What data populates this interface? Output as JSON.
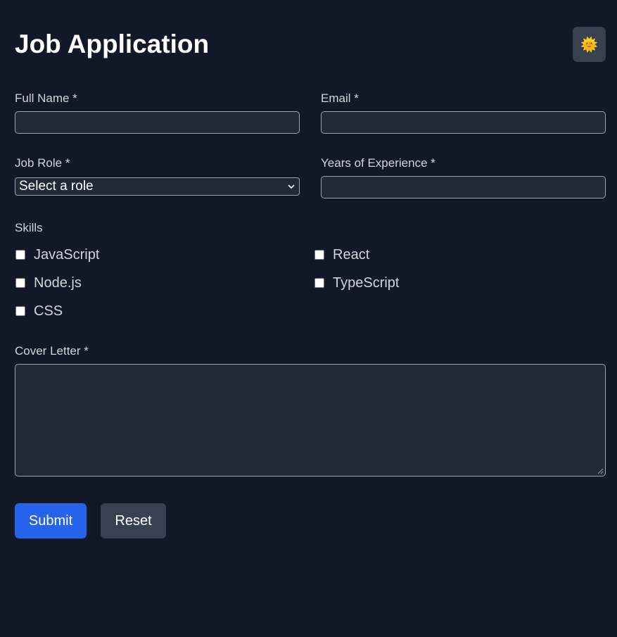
{
  "header": {
    "title": "Job Application",
    "theme_toggle": {
      "icon": "sun-face-icon",
      "glyph": "🌞"
    }
  },
  "form": {
    "full_name": {
      "label": "Full Name *",
      "value": ""
    },
    "email": {
      "label": "Email *",
      "value": ""
    },
    "job_role": {
      "label": "Job Role *",
      "selected": "Select a role"
    },
    "experience": {
      "label": "Years of Experience *",
      "value": ""
    },
    "skills": {
      "label": "Skills",
      "items": [
        {
          "label": "JavaScript",
          "checked": false
        },
        {
          "label": "React",
          "checked": false
        },
        {
          "label": "Node.js",
          "checked": false
        },
        {
          "label": "TypeScript",
          "checked": false
        },
        {
          "label": "CSS",
          "checked": false
        }
      ]
    },
    "cover_letter": {
      "label": "Cover Letter *",
      "value": ""
    }
  },
  "actions": {
    "submit_label": "Submit",
    "reset_label": "Reset"
  },
  "colors": {
    "background": "#111827",
    "field_background": "#1f2937",
    "primary": "#2563eb",
    "secondary": "#374151"
  }
}
